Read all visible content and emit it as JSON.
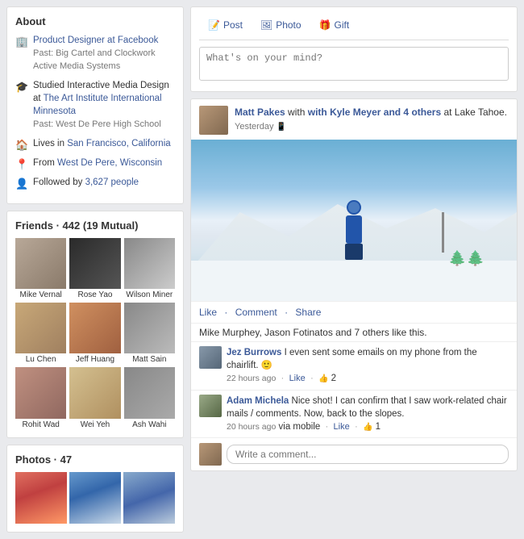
{
  "about": {
    "title": "About",
    "items": [
      {
        "icon": "💼",
        "main": "Product Designer at Facebook",
        "sub": "Past: Big Cartel and Clockwork Active Media Systems"
      },
      {
        "icon": "🎓",
        "main": "Studied Interactive Media Design at The Art Institute International Minnesota",
        "sub": "Past: West De Pere High School"
      },
      {
        "icon": "🏠",
        "main": "Lives in San Francisco, California",
        "sub": ""
      },
      {
        "icon": "📍",
        "main": "From West De Pere, Wisconsin",
        "sub": ""
      },
      {
        "icon": "👥",
        "main": "Followed by 3,627 people",
        "sub": ""
      }
    ]
  },
  "friends": {
    "title": "Friends",
    "count": "442",
    "mutual": "19 Mutual",
    "items": [
      {
        "name": "Mike Vernal",
        "colorClass": "fp-1"
      },
      {
        "name": "Rose Yao",
        "colorClass": "fp-2"
      },
      {
        "name": "Wilson Miner",
        "colorClass": "fp-3"
      },
      {
        "name": "Lu Chen",
        "colorClass": "fp-4"
      },
      {
        "name": "Jeff Huang",
        "colorClass": "fp-5"
      },
      {
        "name": "Matt Sain",
        "colorClass": "fp-6"
      },
      {
        "name": "Rohit Wad",
        "colorClass": "fp-7"
      },
      {
        "name": "Wei Yeh",
        "colorClass": "fp-8"
      },
      {
        "name": "Ash Wahi",
        "colorClass": "fp-9"
      }
    ]
  },
  "photos": {
    "title": "Photos",
    "count": "47",
    "items": [
      {
        "colorClass": "pt-1"
      },
      {
        "colorClass": "pt-2"
      },
      {
        "colorClass": "pt-3"
      }
    ]
  },
  "compose": {
    "tabs": [
      {
        "label": "Post",
        "icon": "📝"
      },
      {
        "label": "Photo",
        "icon": "🖼"
      },
      {
        "label": "Gift",
        "icon": "🎁"
      }
    ],
    "placeholder": "What's on your mind?"
  },
  "feed": {
    "author": "Matt Pakes",
    "with": "with Kyle Meyer and 4 others",
    "location": "at Lake Tahoe.",
    "time": "Yesterday",
    "actions": {
      "like": "Like",
      "comment": "Comment",
      "share": "Share"
    },
    "likes_text": "Mike Murphey, Jason Fotinatos and 7 others like this.",
    "comments": [
      {
        "name": "Jez Burrows",
        "text": "I even sent some emails on my phone from the chairlift. 🙂",
        "time": "22 hours ago",
        "via": "",
        "likes": "2",
        "likes_icon": "👍"
      },
      {
        "name": "Adam Michela",
        "text": "Nice shot! I can confirm that I saw work-related chair mails / comments. Now, back to the slopes.",
        "time": "20 hours ago",
        "via": "via mobile",
        "likes": "1",
        "likes_icon": "👍"
      }
    ],
    "comment_placeholder": "Write a comment..."
  }
}
